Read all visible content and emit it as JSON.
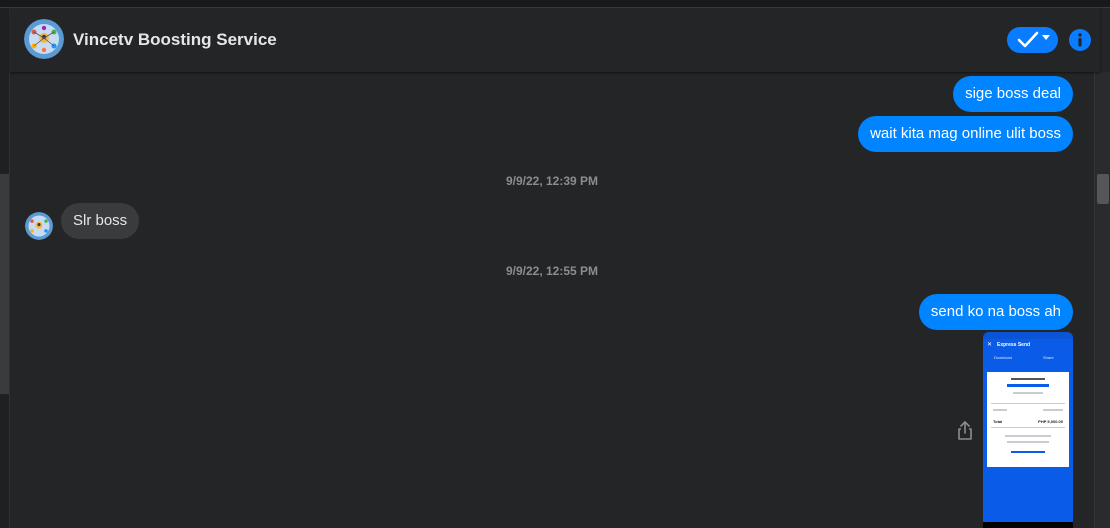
{
  "conversation": {
    "title": "Vincetv Boosting Service",
    "avatar_icon": "group-logo-icon"
  },
  "header": {
    "status_button_icon": "check-icon",
    "status_caret_icon": "caret-down-icon",
    "info_icon": "info-icon"
  },
  "messages": [
    {
      "direction": "outgoing",
      "text": "sige boss deal"
    },
    {
      "direction": "outgoing",
      "text": "wait kita mag online ulit boss"
    },
    {
      "type": "timestamp",
      "text": "9/9/22, 12:39 PM"
    },
    {
      "direction": "incoming",
      "text": "Slr boss"
    },
    {
      "type": "timestamp",
      "text": "9/9/22, 12:55 PM"
    },
    {
      "direction": "outgoing",
      "text": "send ko na boss ah"
    },
    {
      "direction": "outgoing",
      "type": "image",
      "image": {
        "header_title": "Express Send",
        "download_label": "Download",
        "share_label": "Share",
        "total_label": "Total",
        "total_value": "PHP 5,000.00"
      }
    }
  ],
  "share_icon": "share-icon",
  "colors": {
    "outgoing_bubble": "#0084ff",
    "incoming_bubble": "#3a3b3c",
    "accent": "#0a7cff",
    "background": "#242526"
  }
}
